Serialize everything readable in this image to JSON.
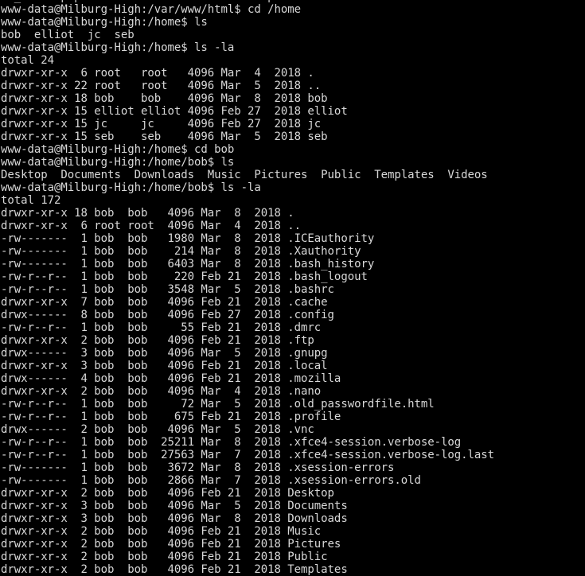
{
  "terminal": {
    "title": "www-data@Milburg-High",
    "colors": {
      "background": "#000000",
      "foreground": "#d8d8d8"
    },
    "host": "Milburg-High",
    "user": "www-data",
    "prompts": [
      "www-data@Milburg-High:/var/www/html$ cd /home",
      "www-data@Milburg-High:/home$ ls",
      "www-data@Milburg-High:/home$ ls -la",
      "www-data@Milburg-High:/home$ cd bob",
      "www-data@Milburg-High:/home/bob$ ls",
      "www-data@Milburg-High:/home/bob$ ls -la"
    ],
    "lines": [
      "rd_admin.php      index.html.bak        password.html",
      "www-data@Milburg-High:/var/www/html$ cd /home",
      "www-data@Milburg-High:/home$ ls",
      "bob  elliot  jc  seb",
      "www-data@Milburg-High:/home$ ls -la",
      "total 24",
      "drwxr-xr-x  6 root   root   4096 Mar  4  2018 .",
      "drwxr-xr-x 22 root   root   4096 Mar  5  2018 ..",
      "drwxr-xr-x 18 bob    bob    4096 Mar  8  2018 bob",
      "drwxr-xr-x 15 elliot elliot 4096 Feb 27  2018 elliot",
      "drwxr-xr-x 15 jc     jc     4096 Feb 27  2018 jc",
      "drwxr-xr-x 15 seb    seb    4096 Mar  5  2018 seb",
      "www-data@Milburg-High:/home$ cd bob",
      "www-data@Milburg-High:/home/bob$ ls",
      "Desktop  Documents  Downloads  Music  Pictures  Public  Templates  Videos",
      "www-data@Milburg-High:/home/bob$ ls -la",
      "total 172",
      "drwxr-xr-x 18 bob  bob   4096 Mar  8  2018 .",
      "drwxr-xr-x  6 root root  4096 Mar  4  2018 ..",
      "-rw-------  1 bob  bob   1980 Mar  8  2018 .ICEauthority",
      "-rw-------  1 bob  bob    214 Mar  8  2018 .Xauthority",
      "-rw-------  1 bob  bob   6403 Mar  8  2018 .bash_history",
      "-rw-r--r--  1 bob  bob    220 Feb 21  2018 .bash_logout",
      "-rw-r--r--  1 bob  bob   3548 Mar  5  2018 .bashrc",
      "drwxr-xr-x  7 bob  bob   4096 Feb 21  2018 .cache",
      "drwx------  8 bob  bob   4096 Feb 27  2018 .config",
      "-rw-r--r--  1 bob  bob     55 Feb 21  2018 .dmrc",
      "drwxr-xr-x  2 bob  bob   4096 Feb 21  2018 .ftp",
      "drwx------  3 bob  bob   4096 Mar  5  2018 .gnupg",
      "drwxr-xr-x  3 bob  bob   4096 Feb 21  2018 .local",
      "drwx------  4 bob  bob   4096 Feb 21  2018 .mozilla",
      "drwxr-xr-x  2 bob  bob   4096 Mar  4  2018 .nano",
      "-rw-r--r--  1 bob  bob     72 Mar  5  2018 .old_passwordfile.html",
      "-rw-r--r--  1 bob  bob    675 Feb 21  2018 .profile",
      "drwx------  2 bob  bob   4096 Mar  5  2018 .vnc",
      "-rw-r--r--  1 bob  bob  25211 Mar  8  2018 .xfce4-session.verbose-log",
      "-rw-r--r--  1 bob  bob  27563 Mar  7  2018 .xfce4-session.verbose-log.last",
      "-rw-------  1 bob  bob   3672 Mar  8  2018 .xsession-errors",
      "-rw-------  1 bob  bob   2866 Mar  7  2018 .xsession-errors.old",
      "drwxr-xr-x  2 bob  bob   4096 Feb 21  2018 Desktop",
      "drwxr-xr-x  3 bob  bob   4096 Mar  5  2018 Documents",
      "drwxr-xr-x  3 bob  bob   4096 Mar  8  2018 Downloads",
      "drwxr-xr-x  2 bob  bob   4096 Feb 21  2018 Music",
      "drwxr-xr-x  2 bob  bob   4096 Feb 21  2018 Pictures",
      "drwxr-xr-x  2 bob  bob   4096 Feb 21  2018 Public",
      "drwxr-xr-x  2 bob  bob   4096 Feb 21  2018 Templates"
    ]
  }
}
